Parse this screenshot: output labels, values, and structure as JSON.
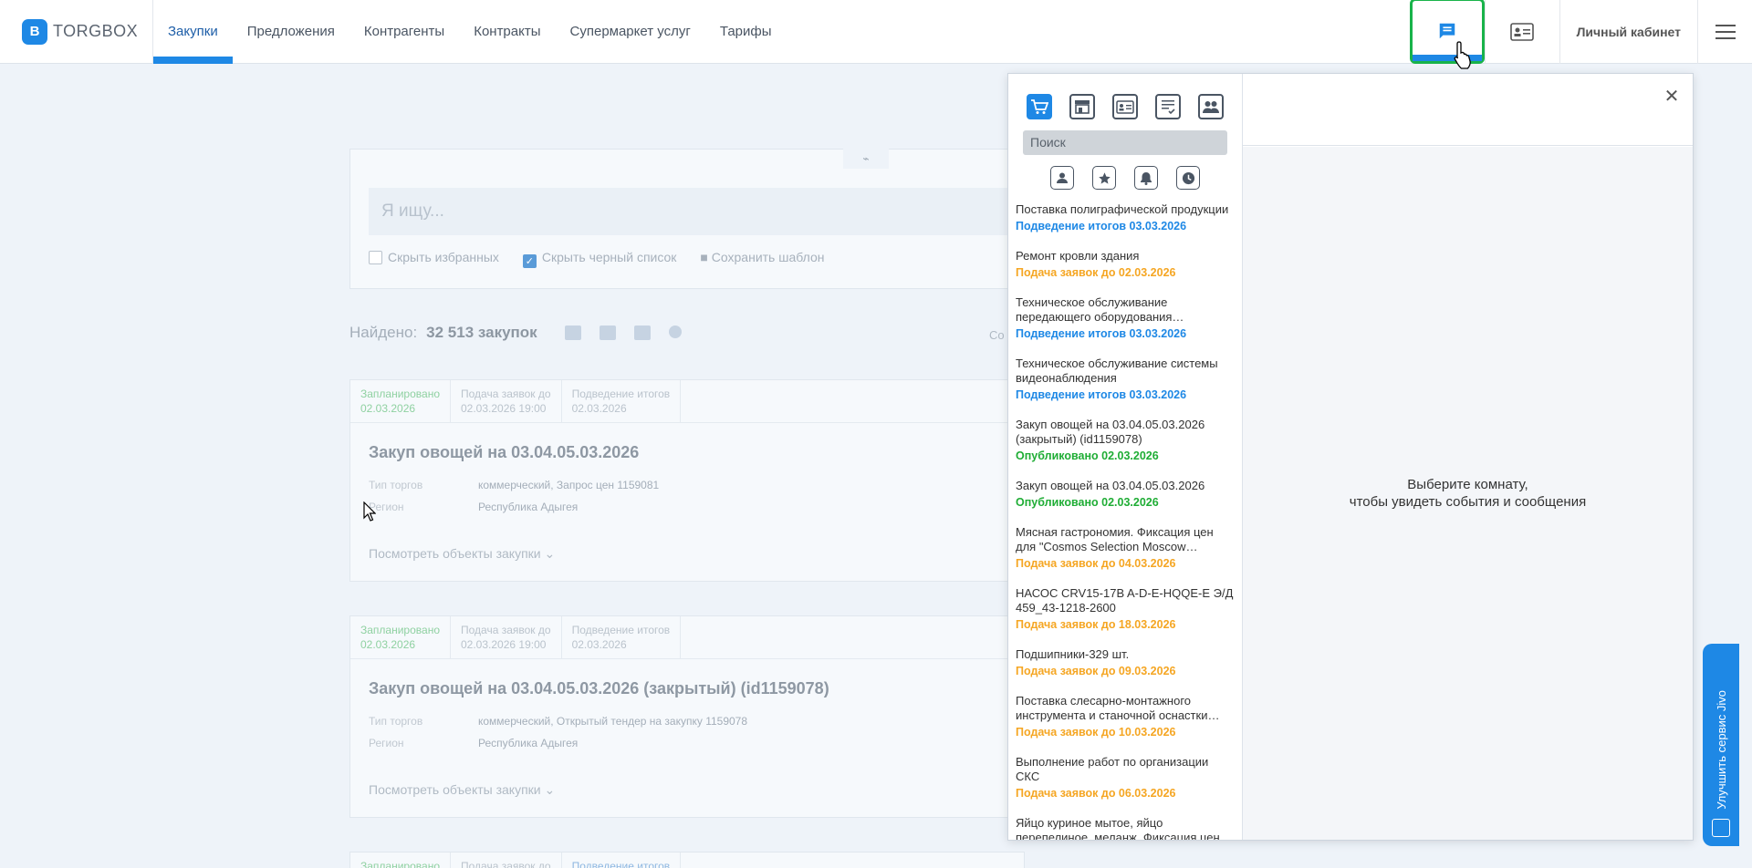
{
  "header": {
    "logo_text": "TORGBOX",
    "nav": [
      "Закупки",
      "Предложения",
      "Контрагенты",
      "Контракты",
      "Супермаркет услуг",
      "Тарифы"
    ],
    "cabinet_label": "Личный кабинет"
  },
  "search": {
    "placeholder": "Я ищу...",
    "hide_favorites": "Скрыть избранных",
    "hide_blacklist": "Скрыть черный список",
    "save_template": "Сохранить шаблон"
  },
  "results": {
    "found_label": "Найдено:",
    "found_count": "32 513 закупок",
    "sort_label": "Со"
  },
  "tenders": [
    {
      "planned_label": "Запланировано",
      "planned_date": "02.03.2026",
      "submit_label": "Подача заявок до",
      "submit_date": "02.03.2026 19:00",
      "summary_label": "Подведение итогов",
      "summary_date": "02.03.2026",
      "title": "Закуп овощей на 03.04.05.03.2026",
      "type_label": "Тип торгов",
      "type_value": "коммерческий, Запрос цен 1159081",
      "region_label": "Регион",
      "region_value": "Республика Адыгея",
      "link": "Посмотреть объекты закупки"
    },
    {
      "planned_label": "Запланировано",
      "planned_date": "02.03.2026",
      "submit_label": "Подача заявок до",
      "submit_date": "02.03.2026 19:00",
      "summary_label": "Подведение итогов",
      "summary_date": "02.03.2026",
      "title": "Закуп овощей на 03.04.05.03.2026 (закрытый) (id1159078)",
      "type_label": "Тип торгов",
      "type_value": "коммерческий, Открытый тендер на закупку 1159078",
      "region_label": "Регион",
      "region_value": "Республика Адыгея",
      "link": "Посмотреть объекты закупки"
    },
    {
      "planned_label": "Запланировано",
      "submit_label": "Подача заявок до",
      "summary_label": "Подведение итогов"
    }
  ],
  "chat": {
    "search_placeholder": "Поиск",
    "empty_line1": "Выберите комнату,",
    "empty_line2": "чтобы увидеть события и сообщения",
    "rooms": [
      {
        "title": "Поставка полиграфической продукции",
        "status": "Подведение итогов 03.03.2026",
        "color": "blue"
      },
      {
        "title": "Ремонт кровли здания",
        "status": "Подача заявок до 02.03.2026",
        "color": "orange"
      },
      {
        "title": "Техническое обслуживание передающего оборудования…",
        "status": "Подведение итогов 03.03.2026",
        "color": "blue"
      },
      {
        "title": "Техническое обслуживание системы видеонаблюдения",
        "status": "Подведение итогов 03.03.2026",
        "color": "blue"
      },
      {
        "title": "Закуп овощей на 03.04.05.03.2026 (закрытый) (id1159078)",
        "status": "Опубликовано 02.03.2026",
        "color": "green"
      },
      {
        "title": "Закуп овощей на 03.04.05.03.2026",
        "status": "Опубликовано 02.03.2026",
        "color": "green"
      },
      {
        "title": "Мясная гастрономия. Фиксация цен для \"Cosmos Selection Moscow…",
        "status": "Подача заявок до 04.03.2026",
        "color": "orange"
      },
      {
        "title": "НАСОС CRV15-17B A-D-E-HQQE-E Э/Д 459_43-1218-2600",
        "status": "Подача заявок до 18.03.2026",
        "color": "orange"
      },
      {
        "title": "Подшипники-329 шт.",
        "status": "Подача заявок до 09.03.2026",
        "color": "orange"
      },
      {
        "title": "Поставка слесарно-монтажного инструмента и станочной оснастки дл…",
        "status": "Подача заявок до 10.03.2026",
        "color": "orange"
      },
      {
        "title": "Выполнение работ по организации СКС",
        "status": "Подача заявок до 06.03.2026",
        "color": "orange"
      },
      {
        "title": "Яйцо куриное мытое, яйцо перепелиное, меланж. Фиксация цен…",
        "status": "",
        "color": "orange"
      }
    ]
  },
  "jivo": {
    "label": "Улучшить сервис Jivo"
  },
  "colors": {
    "accent": "#1e88e5",
    "green": "#1fad35",
    "orange": "#f5a623"
  }
}
